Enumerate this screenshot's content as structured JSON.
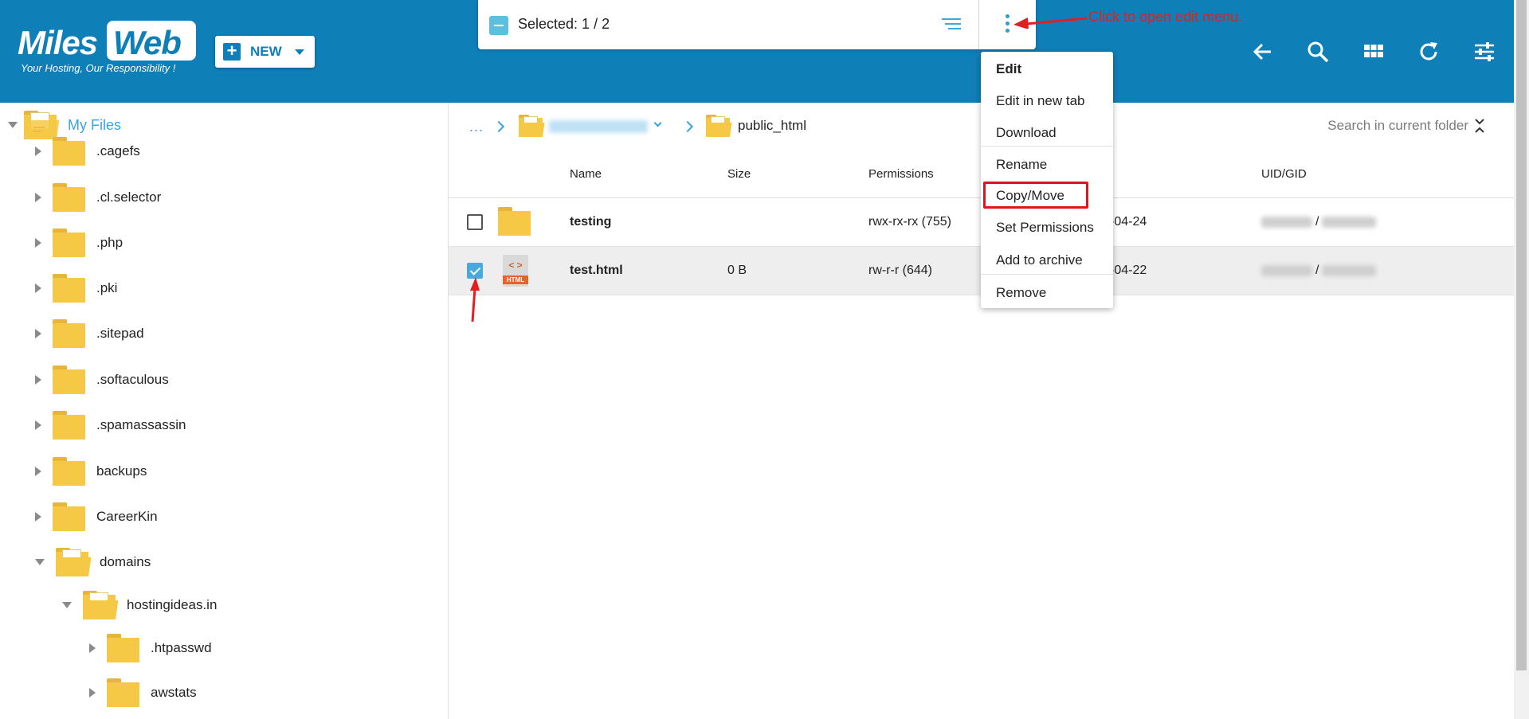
{
  "brand": {
    "logo_word1": "Miles",
    "logo_word2": "Web",
    "tagline": "Your Hosting, Our Responsibility !"
  },
  "toolbar": {
    "new_label": "NEW",
    "selected_text": "Selected: 1 / 2",
    "annotation": "Click to open edit menu."
  },
  "header_icons": [
    "back-arrow-icon",
    "search-icon",
    "grid-view-icon",
    "refresh-icon",
    "settings-sliders-icon"
  ],
  "sidebar": {
    "root_label": "My Files",
    "items": [
      {
        "label": ".cagefs",
        "expanded": false
      },
      {
        "label": ".cl.selector",
        "expanded": false
      },
      {
        "label": ".php",
        "expanded": false
      },
      {
        "label": ".pki",
        "expanded": false
      },
      {
        "label": ".sitepad",
        "expanded": false
      },
      {
        "label": ".softaculous",
        "expanded": false
      },
      {
        "label": ".spamassassin",
        "expanded": false
      },
      {
        "label": "backups",
        "expanded": false
      },
      {
        "label": "CareerKin",
        "expanded": false
      },
      {
        "label": "domains",
        "expanded": true
      },
      {
        "label": "hostingideas.in",
        "expanded": true
      },
      {
        "label": ".htpasswd",
        "expanded": false
      },
      {
        "label": "awstats",
        "expanded": false
      }
    ]
  },
  "breadcrumb": {
    "ellipsis": "...",
    "current": "public_html"
  },
  "search": {
    "placeholder": "Search in current folder"
  },
  "table": {
    "columns": {
      "name": "Name",
      "size": "Size",
      "permissions": "Permissions",
      "uid": "UID/GID"
    },
    "rows": [
      {
        "name": "testing",
        "size": "",
        "permissions": "rwx-rx-rx (755)",
        "date": "-04-24",
        "uid_sep": "/",
        "selected": false,
        "type": "folder"
      },
      {
        "name": "test.html",
        "size": "0 B",
        "permissions": "rw-r-r (644)",
        "date": "-04-22",
        "uid_sep": "/",
        "selected": true,
        "type": "html"
      }
    ]
  },
  "html_icon": {
    "badge": "HTML",
    "code": "< >"
  },
  "context_menu": {
    "items": [
      "Edit",
      "Edit in new tab",
      "Download",
      "Rename",
      "Copy/Move",
      "Set Permissions",
      "Add to archive",
      "Remove"
    ],
    "highlighted": "Copy/Move"
  },
  "colors": {
    "header_bg": "#0f7fb8",
    "accent": "#3aa3dd",
    "annotation": "#e02020",
    "folder": "#f5c945"
  }
}
